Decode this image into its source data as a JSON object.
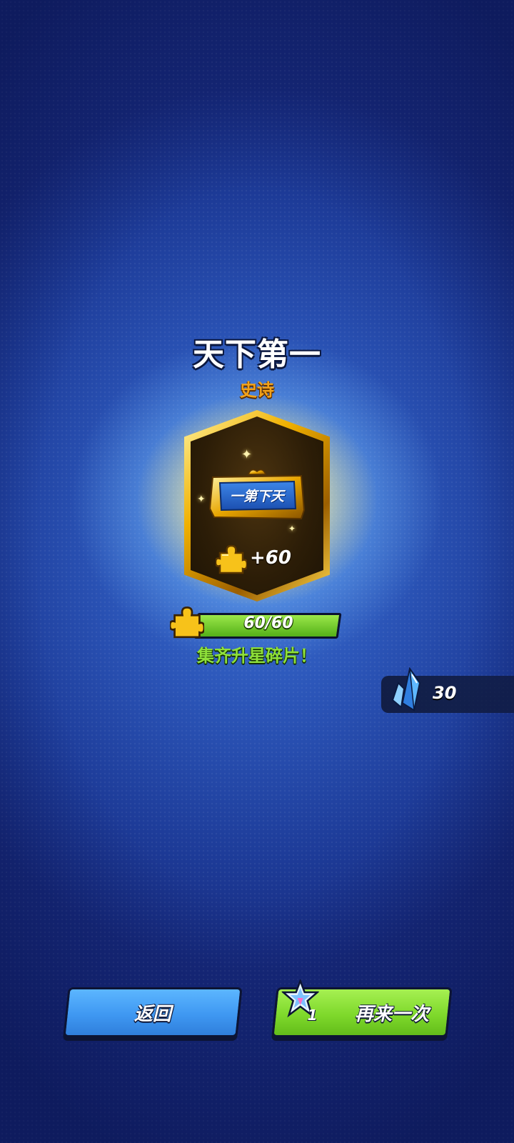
{
  "reward": {
    "title": "天下第一",
    "rarity": "史诗",
    "plaque_text": "一第下天",
    "shard_amount": "+60"
  },
  "progress": {
    "text": "60/60",
    "fraction": 1.0,
    "message": "集齐升星碎片！"
  },
  "currency": {
    "crystal_count": "30"
  },
  "buttons": {
    "back_label": "返回",
    "again_label": "再来一次",
    "again_ticket_count": "1"
  },
  "colors": {
    "title": "#ffffff",
    "rarity": "#f2a21a",
    "progress_fill": "#7fd92c",
    "collect_message": "#8fe03a",
    "back_button": "#3f98f2",
    "again_button": "#7fd92c"
  },
  "icons": {
    "shard": "puzzle-piece-icon",
    "crystal": "blue-crystal-icon",
    "ticket": "star-crystal-ticket-icon"
  }
}
